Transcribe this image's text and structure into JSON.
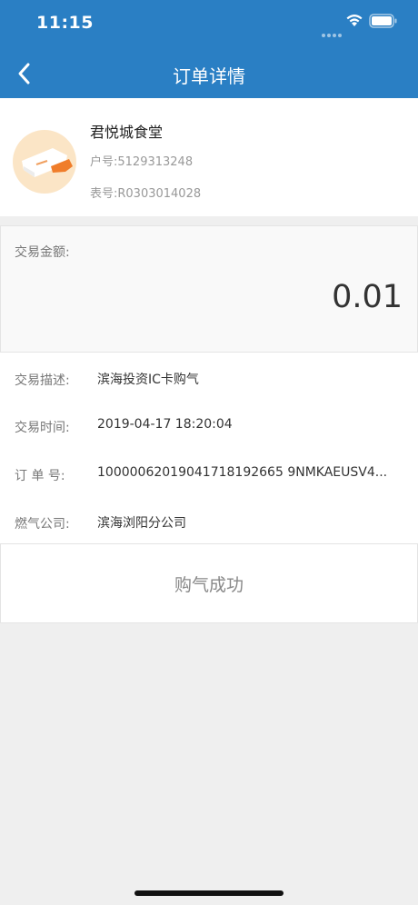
{
  "status": {
    "time": "11:15"
  },
  "nav": {
    "title": "订单详情"
  },
  "merchant": {
    "name": "君悦城食堂",
    "account": "户号:5129313248",
    "meter": "表号:R0303014028"
  },
  "amount": {
    "label": "交易金额:",
    "value": "0.01"
  },
  "details": [
    {
      "label": "交易描述:",
      "value": "滨海投资IC卡购气"
    },
    {
      "label": "交易时间:",
      "value": "2019-04-17 18:20:04"
    },
    {
      "label": "订 单 号:",
      "value": "10000062019041718192665 9NMKAEUSV4..."
    },
    {
      "label": "燃气公司:",
      "value": "滨海浏阳分公司"
    }
  ],
  "result": {
    "text": "购气成功"
  },
  "colors": {
    "header": "#2a7fc4",
    "background": "#efefef"
  },
  "icons": {
    "back": "chevron-left-icon",
    "wifi": "wifi-icon",
    "battery": "battery-icon"
  }
}
